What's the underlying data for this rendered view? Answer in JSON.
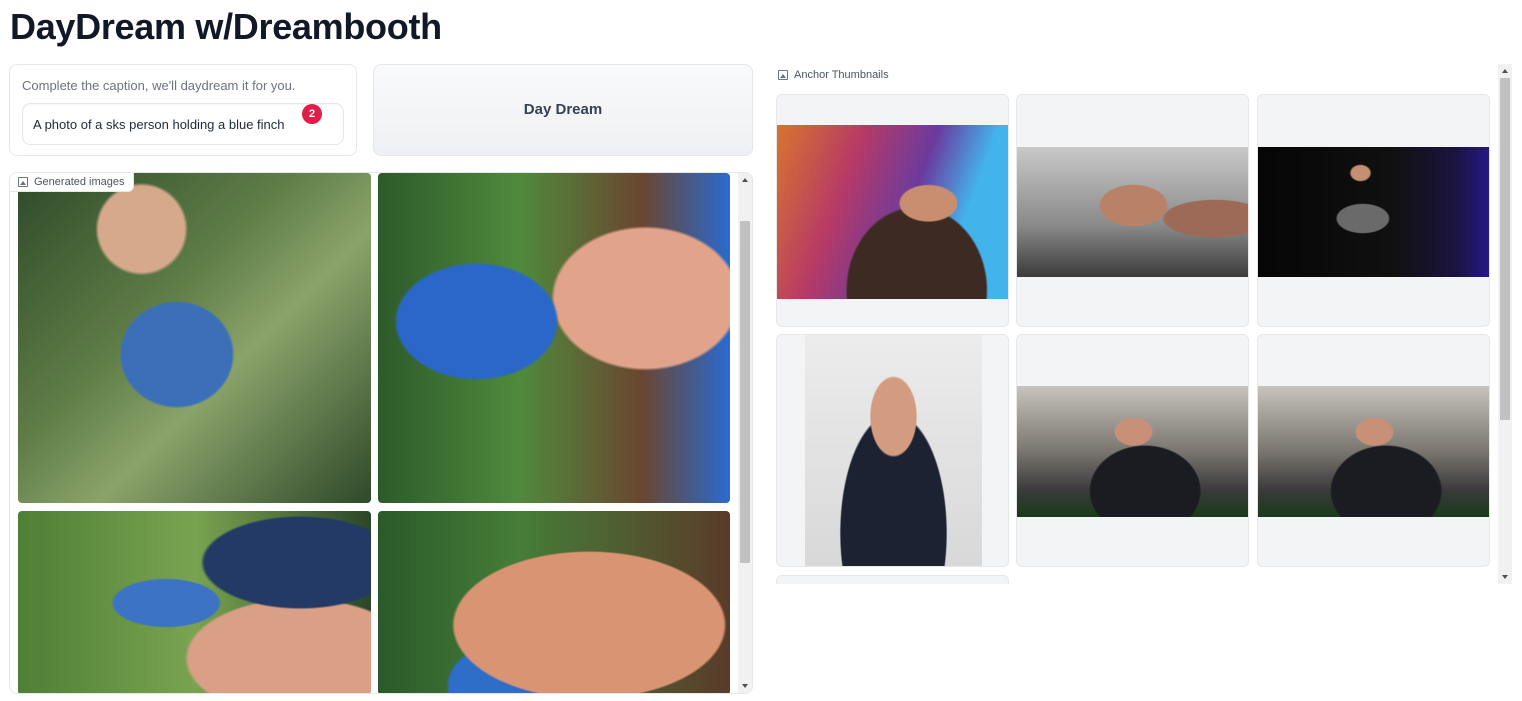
{
  "page": {
    "title": "DayDream w/Dreambooth"
  },
  "caption": {
    "label": "Complete the caption, we'll daydream it for you.",
    "value": "A photo of a sks person holding a blue finch",
    "badge_count": "2"
  },
  "actions": {
    "day_dream_label": "Day Dream"
  },
  "generated": {
    "label": "Generated images",
    "icon": "image-icon",
    "images": [
      {
        "name": "generated-image-1"
      },
      {
        "name": "generated-image-2"
      },
      {
        "name": "generated-image-3"
      },
      {
        "name": "generated-image-4"
      }
    ]
  },
  "anchors": {
    "label": "Anchor Thumbnails",
    "icon": "image-icon",
    "thumbnails": [
      {
        "name": "anchor-thumbnail-1"
      },
      {
        "name": "anchor-thumbnail-2"
      },
      {
        "name": "anchor-thumbnail-3"
      },
      {
        "name": "anchor-thumbnail-4"
      },
      {
        "name": "anchor-thumbnail-5"
      },
      {
        "name": "anchor-thumbnail-6"
      },
      {
        "name": "anchor-thumbnail-7"
      }
    ]
  },
  "colors": {
    "badge": "#e11d48",
    "border": "#e5e7eb",
    "button_bg": "#f3f4f6"
  }
}
